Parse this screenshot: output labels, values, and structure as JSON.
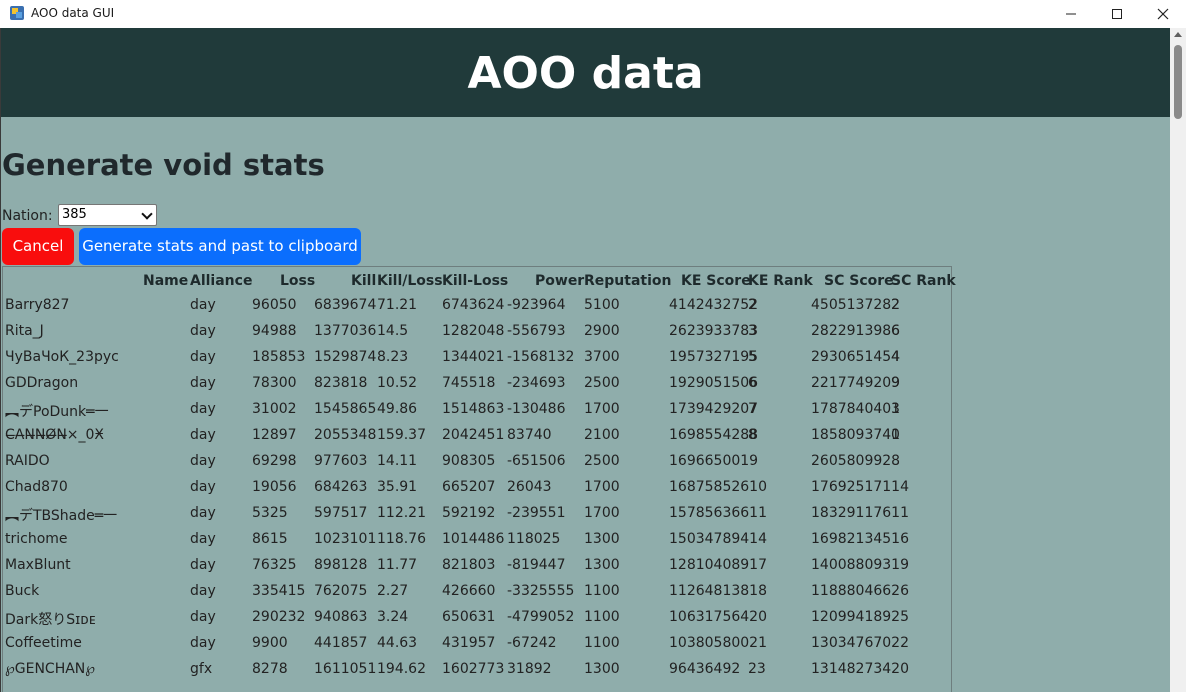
{
  "window": {
    "title": "AOO data GUI",
    "icons": {
      "app": "app-logo-icon",
      "minimize": "minimize-icon",
      "maximize": "maximize-icon",
      "close": "close-icon"
    }
  },
  "header": {
    "title": "AOO data"
  },
  "section": {
    "title": "Generate void stats"
  },
  "form": {
    "nation_label": "Nation:",
    "nation_value": "385",
    "cancel_label": "Cancel",
    "generate_label": "Generate stats and past to clipboard"
  },
  "colors": {
    "banner": "#203a3a",
    "page_bg": "#8fadab",
    "cancel_button": "#f90d0d",
    "generate_button": "#0b6efd"
  },
  "table": {
    "columns": [
      "Name",
      "Alliance",
      "Loss",
      "Kill",
      "Kill/Loss",
      "Kill-Loss",
      "Power",
      "Reputation",
      "KE Score",
      "KE Rank",
      "SC Score",
      "SC Rank"
    ],
    "rows": [
      [
        "Barry827",
        "day",
        "96050",
        "6839674",
        "71.21",
        "6743624",
        "-923964",
        "5100",
        "4142432752",
        "2",
        "4505137282",
        "2"
      ],
      [
        "Rita_J",
        "day",
        "94988",
        "1377036",
        "14.5",
        "1282048",
        "-556793",
        "2900",
        "2623933783",
        "3",
        "2822913986",
        "6"
      ],
      [
        "ЧуВаЧоК_23рус",
        "day",
        "185853",
        "1529874",
        "8.23",
        "1344021",
        "-1568132",
        "3700",
        "1957327195",
        "5",
        "2930651454",
        "4"
      ],
      [
        "GDDragon",
        "day",
        "78300",
        "823818",
        "10.52",
        "745518",
        "-234693",
        "2500",
        "1929051506",
        "6",
        "2217749209",
        "9"
      ],
      [
        "︻デPoDunk═一",
        "day",
        "31002",
        "1545865",
        "49.86",
        "1514863",
        "-130486",
        "1700",
        "1739429207",
        "7",
        "1787840401",
        "3"
      ],
      [
        "C̶A̶N̶N̶Ø̶N̶×_0Ӿ",
        "day",
        "12897",
        "2055348",
        "159.37",
        "2042451",
        "83740",
        "2100",
        "1698554288",
        "8",
        "1858093741",
        "0"
      ],
      [
        "RAIDO",
        "day",
        "69298",
        "977603",
        "14.11",
        "908305",
        "-651506",
        "2500",
        "1696650019",
        "",
        "2605809928",
        ""
      ],
      [
        "Chad870",
        "day",
        "19056",
        "684263",
        "35.91",
        "665207",
        "26043",
        "1700",
        "16875852610",
        "",
        "17692517114",
        ""
      ],
      [
        "︻デTBShade═一",
        "day",
        "5325",
        "597517",
        "112.21",
        "592192",
        "-239551",
        "1700",
        "15785636611",
        "",
        "18329117611",
        ""
      ],
      [
        "trichome",
        "day",
        "8615",
        "1023101",
        "118.76",
        "1014486",
        "118025",
        "1300",
        "15034789414",
        "",
        "16982134516",
        ""
      ],
      [
        "MaxBlunt",
        "day",
        "76325",
        "898128",
        "11.77",
        "821803",
        "-819447",
        "1300",
        "12810408917",
        "",
        "14008809319",
        ""
      ],
      [
        "Buck",
        "day",
        "335415",
        "762075",
        "2.27",
        "426660",
        "-3325555",
        "1100",
        "11264813818",
        "",
        "11888046626",
        ""
      ],
      [
        "Dark怒りSɪᴅᴇ",
        "day",
        "290232",
        "940863",
        "3.24",
        "650631",
        "-4799052",
        "1100",
        "10631756420",
        "",
        "12099418925",
        ""
      ],
      [
        "Coffeetime",
        "day",
        "9900",
        "441857",
        "44.63",
        "431957",
        "-67242",
        "1100",
        "10380580021",
        "",
        "13034767022",
        ""
      ],
      [
        "℘GENCHAN℘",
        "gfx",
        "8278",
        "1611051",
        "194.62",
        "1602773",
        "31892",
        "1300",
        "96436492",
        "23",
        "13148273420",
        ""
      ]
    ]
  }
}
